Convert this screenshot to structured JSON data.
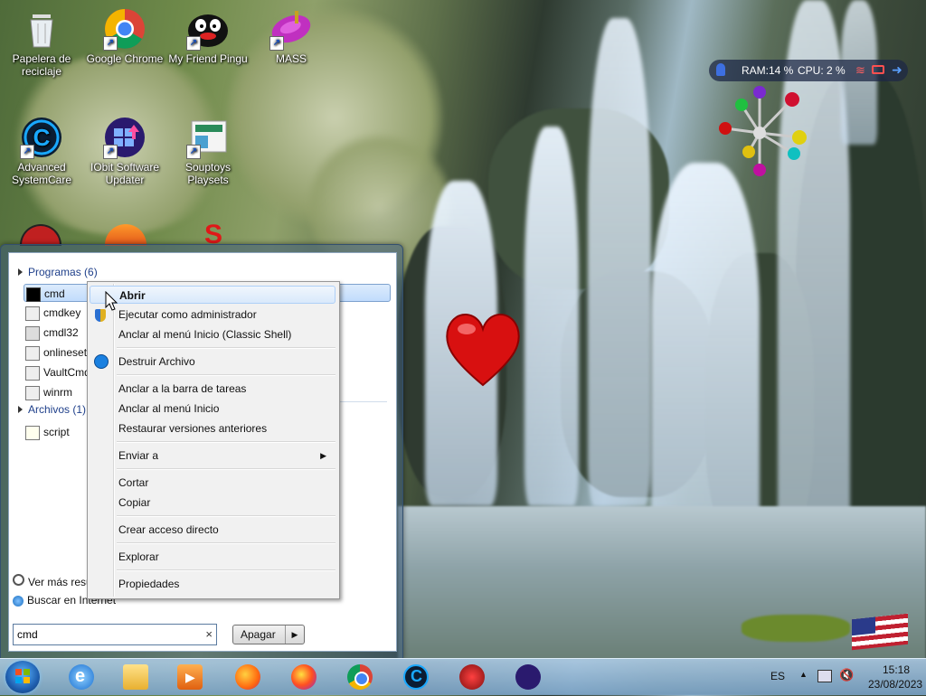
{
  "desktop": {
    "icons": [
      {
        "label": "Papelera de reciclaje",
        "line1": "Papelera de",
        "line2": "reciclaje"
      },
      {
        "label": "Google Chrome"
      },
      {
        "label": "My Friend Pingu"
      },
      {
        "label": "MASS"
      },
      {
        "label": "Advanced SystemCare",
        "line1": "Advanced",
        "line2": "SystemCare"
      },
      {
        "label": "IObit Software Updater",
        "line1": "IObit Software",
        "line2": "Updater"
      },
      {
        "label": "Souptoys Playsets",
        "line1": "Souptoys",
        "line2": "Playsets"
      }
    ]
  },
  "sysmonitor": {
    "ram": "RAM:14 %",
    "cpu": "CPU: 2 %"
  },
  "start_menu": {
    "programs_header": "Programas (6)",
    "programs": [
      "cmd",
      "cmdkey",
      "cmdl32",
      "onlineset",
      "VaultCmd",
      "winrm"
    ],
    "files_header": "Archivos (1)",
    "files": [
      "script"
    ],
    "see_more": "Ver más resu",
    "search_internet": "Buscar en Internet",
    "search_value": "cmd",
    "clear_icon": "×",
    "shutdown_label": "Apagar",
    "shutdown_arrow": "▶"
  },
  "context_menu": {
    "open": "Abrir",
    "run_as_admin": "Ejecutar como administrador",
    "pin_classic": "Anclar al menú Inicio (Classic Shell)",
    "destroy": "Destruir Archivo",
    "pin_taskbar": "Anclar a la barra de tareas",
    "pin_start": "Anclar al menú Inicio",
    "restore": "Restaurar versiones anteriores",
    "send_to": "Enviar a",
    "cut": "Cortar",
    "copy": "Copiar",
    "create_shortcut": "Crear acceso directo",
    "explore": "Explorar",
    "properties": "Propiedades"
  },
  "taskbar": {
    "pinned": [
      "internet-explorer-icon",
      "file-explorer-icon",
      "media-player-icon",
      "firefox-icon",
      "firefox-dev-icon",
      "chrome-icon",
      "advanced-systemcare-icon",
      "iobit-security-icon",
      "iobit-updater-icon"
    ],
    "language": "ES",
    "time": "15:18",
    "date": "23/08/2023"
  },
  "colors": {
    "accent": "#1e3f8a",
    "selection": "#c1dcfc",
    "taskbar": "#8ab0d0"
  }
}
